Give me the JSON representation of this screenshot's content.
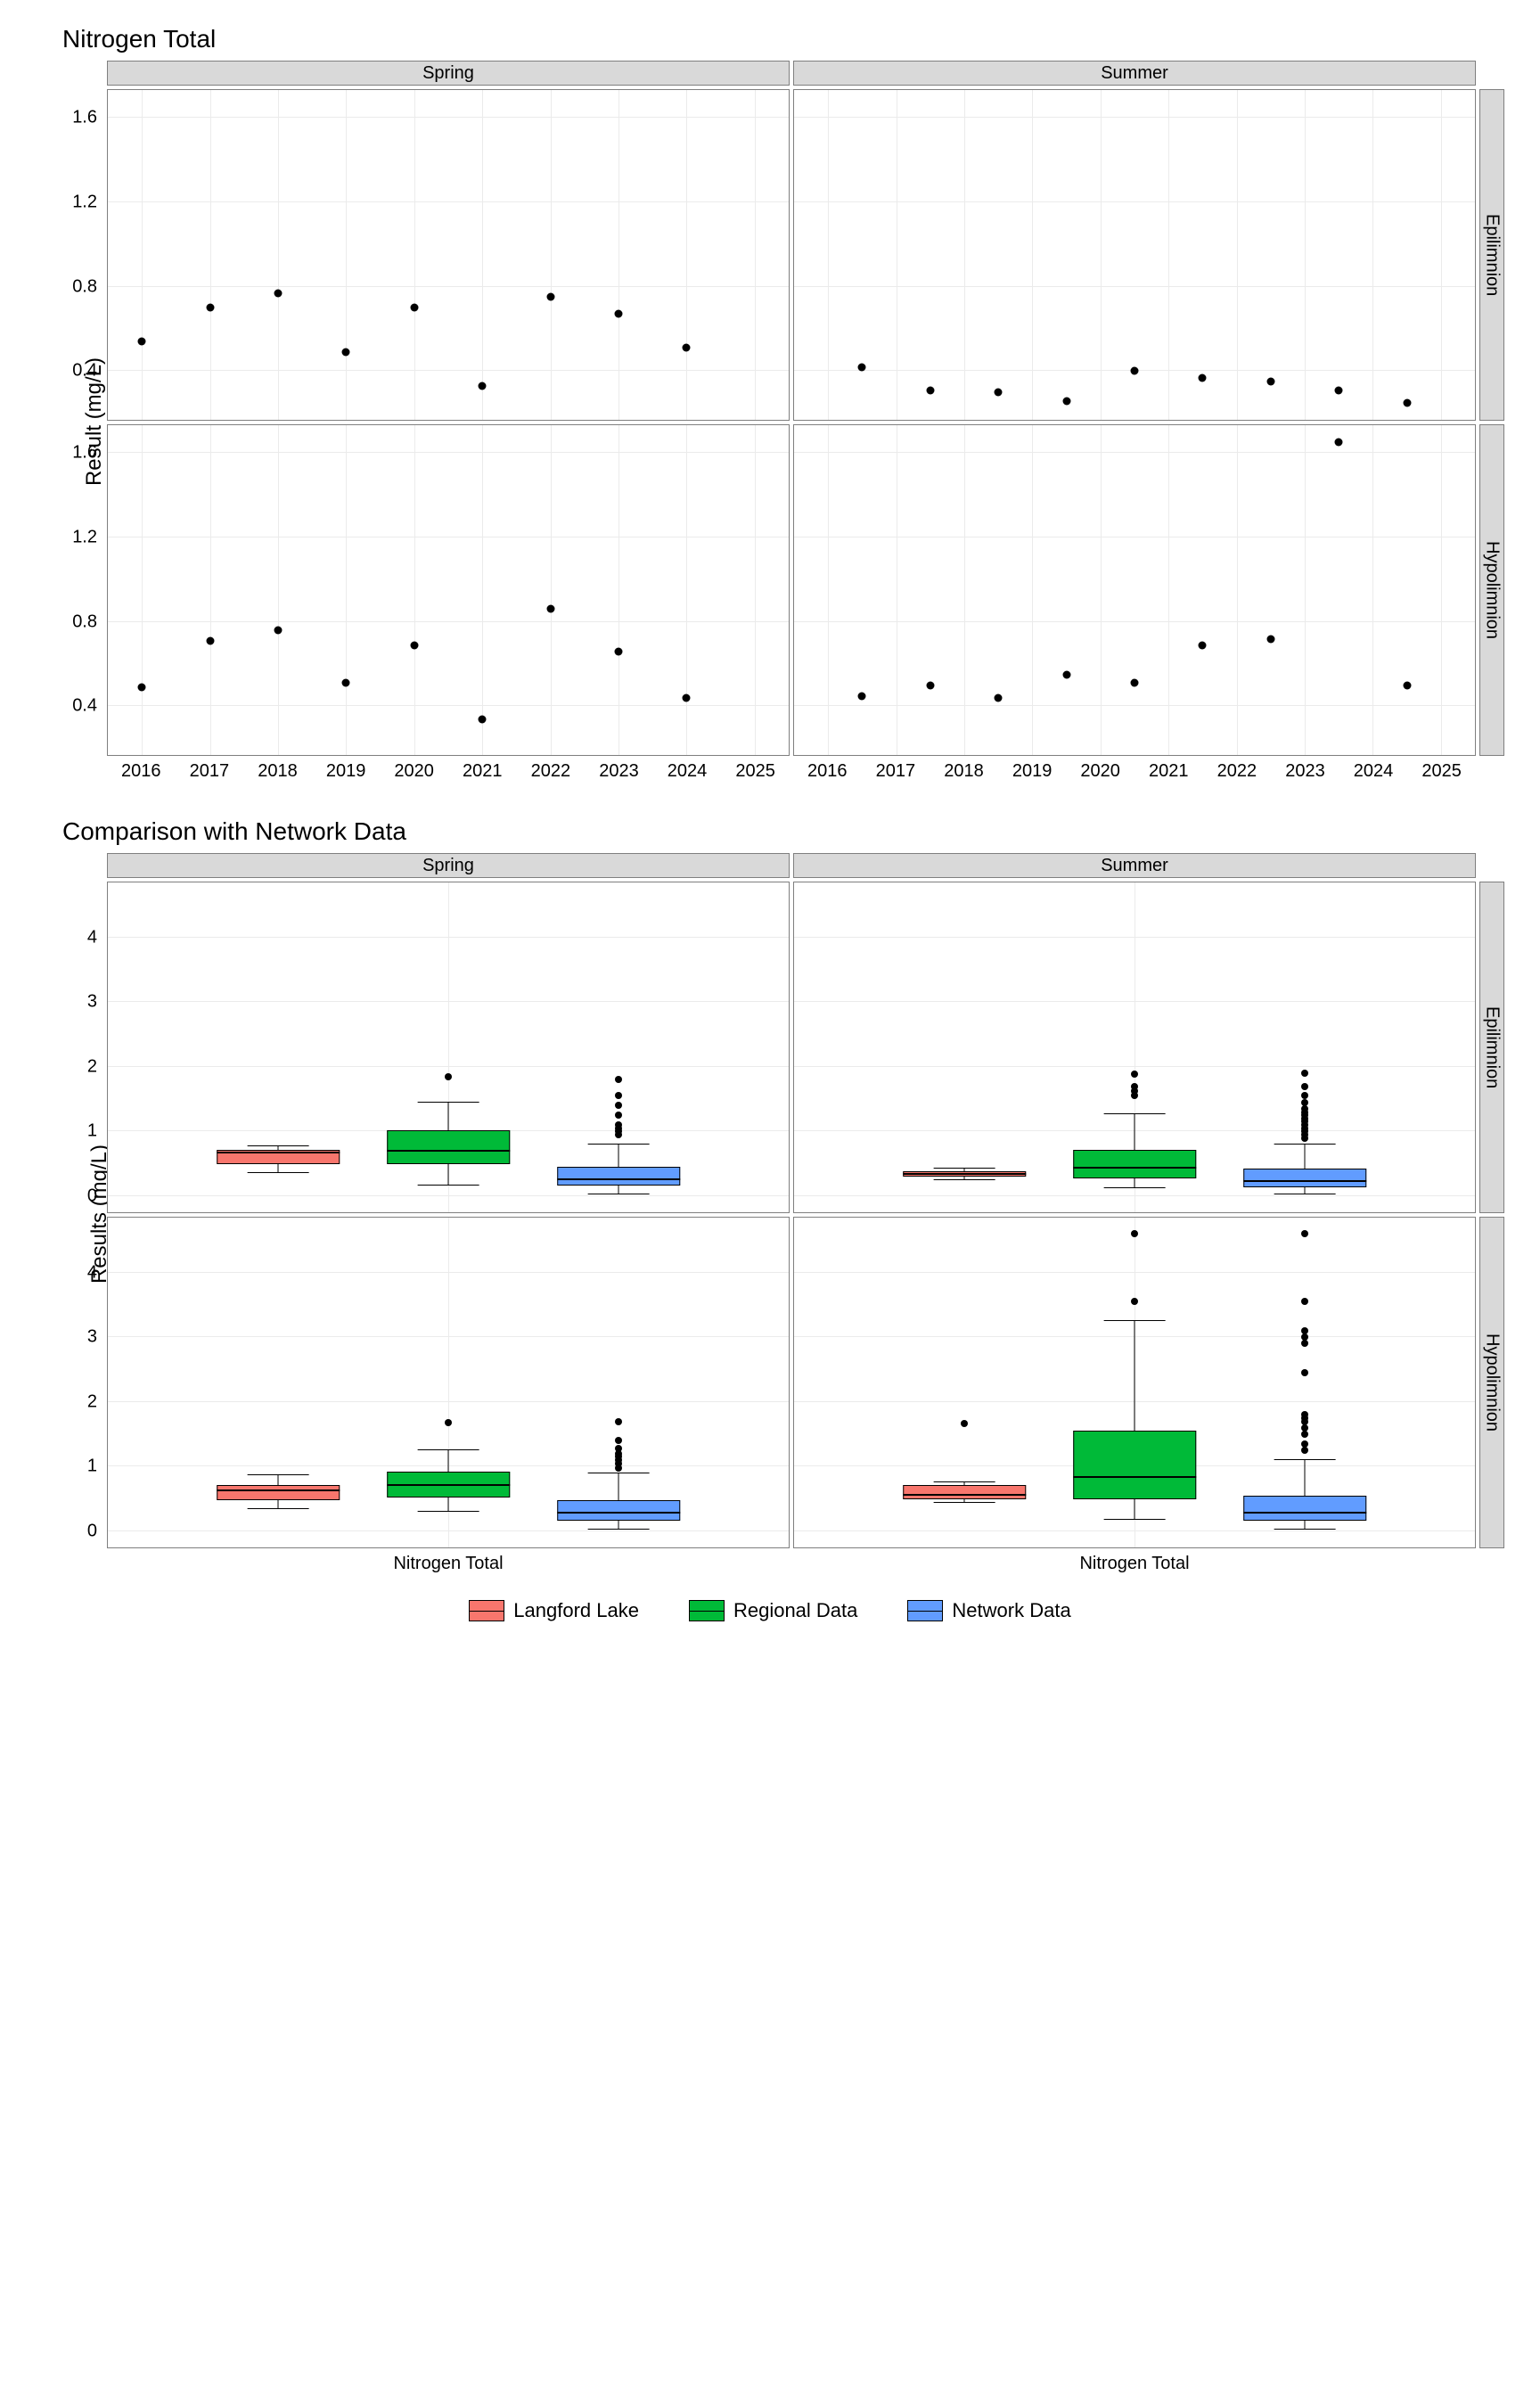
{
  "chart_data": [
    {
      "type": "scatter",
      "title": "Nitrogen Total",
      "ylabel": "Result (mg/L)",
      "cols": [
        "Spring",
        "Summer"
      ],
      "rows": [
        "Epilimnion",
        "Hypolimnion"
      ],
      "x_ticks": [
        "2016",
        "2017",
        "2018",
        "2019",
        "2020",
        "2021",
        "2022",
        "2023",
        "2024",
        "2025"
      ],
      "y_ticks": [
        0.4,
        0.8,
        1.2,
        1.6
      ],
      "xlim": [
        2015.5,
        2025.5
      ],
      "ylim": [
        0.17,
        1.73
      ],
      "panels": {
        "Spring|Epilimnion": [
          {
            "x": 2016,
            "y": 0.54
          },
          {
            "x": 2017,
            "y": 0.7
          },
          {
            "x": 2018,
            "y": 0.77
          },
          {
            "x": 2019,
            "y": 0.49
          },
          {
            "x": 2020,
            "y": 0.7
          },
          {
            "x": 2021,
            "y": 0.33
          },
          {
            "x": 2022,
            "y": 0.75
          },
          {
            "x": 2023,
            "y": 0.67
          },
          {
            "x": 2024,
            "y": 0.51
          }
        ],
        "Summer|Epilimnion": [
          {
            "x": 2016.5,
            "y": 0.42
          },
          {
            "x": 2017.5,
            "y": 0.31
          },
          {
            "x": 2018.5,
            "y": 0.3
          },
          {
            "x": 2019.5,
            "y": 0.26
          },
          {
            "x": 2020.5,
            "y": 0.4
          },
          {
            "x": 2021.5,
            "y": 0.37
          },
          {
            "x": 2022.5,
            "y": 0.35
          },
          {
            "x": 2023.5,
            "y": 0.31
          },
          {
            "x": 2024.5,
            "y": 0.25
          }
        ],
        "Spring|Hypolimnion": [
          {
            "x": 2016,
            "y": 0.49
          },
          {
            "x": 2017,
            "y": 0.71
          },
          {
            "x": 2018,
            "y": 0.76
          },
          {
            "x": 2019,
            "y": 0.51
          },
          {
            "x": 2020,
            "y": 0.69
          },
          {
            "x": 2021,
            "y": 0.34
          },
          {
            "x": 2022,
            "y": 0.86
          },
          {
            "x": 2023,
            "y": 0.66
          },
          {
            "x": 2024,
            "y": 0.44
          }
        ],
        "Summer|Hypolimnion": [
          {
            "x": 2016.5,
            "y": 0.45
          },
          {
            "x": 2017.5,
            "y": 0.5
          },
          {
            "x": 2018.5,
            "y": 0.44
          },
          {
            "x": 2019.5,
            "y": 0.55
          },
          {
            "x": 2020.5,
            "y": 0.51
          },
          {
            "x": 2021.5,
            "y": 0.69
          },
          {
            "x": 2022.5,
            "y": 0.72
          },
          {
            "x": 2023.5,
            "y": 1.65
          },
          {
            "x": 2024.5,
            "y": 0.5
          }
        ]
      }
    },
    {
      "type": "boxplot",
      "title": "Comparison with Network Data",
      "ylabel": "Results (mg/L)",
      "cols": [
        "Spring",
        "Summer"
      ],
      "rows": [
        "Epilimnion",
        "Hypolimnion"
      ],
      "x_label": "Nitrogen Total",
      "y_ticks": [
        0,
        1,
        2,
        3,
        4
      ],
      "ylim": [
        -0.25,
        4.85
      ],
      "series": [
        {
          "name": "Langford Lake",
          "color": "#F8766D"
        },
        {
          "name": "Regional Data",
          "color": "#00BA38"
        },
        {
          "name": "Network Data",
          "color": "#619CFF"
        }
      ],
      "panels": {
        "Spring|Epilimnion": [
          {
            "s": 0,
            "lw": 0.36,
            "q1": 0.5,
            "med": 0.67,
            "q3": 0.72,
            "uw": 0.77,
            "out": []
          },
          {
            "s": 1,
            "lw": 0.16,
            "q1": 0.5,
            "med": 0.68,
            "q3": 1.02,
            "uw": 1.45,
            "out": [
              1.85
            ]
          },
          {
            "s": 2,
            "lw": 0.02,
            "q1": 0.16,
            "med": 0.24,
            "q3": 0.45,
            "uw": 0.8,
            "out": [
              0.95,
              1.0,
              1.05,
              1.1,
              1.25,
              1.4,
              1.55,
              1.8
            ]
          }
        ],
        "Summer|Epilimnion": [
          {
            "s": 0,
            "lw": 0.25,
            "q1": 0.3,
            "med": 0.33,
            "q3": 0.38,
            "uw": 0.42,
            "out": []
          },
          {
            "s": 1,
            "lw": 0.12,
            "q1": 0.28,
            "med": 0.42,
            "q3": 0.72,
            "uw": 1.27,
            "out": [
              1.55,
              1.62,
              1.7,
              1.88
            ]
          },
          {
            "s": 2,
            "lw": 0.03,
            "q1": 0.14,
            "med": 0.22,
            "q3": 0.42,
            "uw": 0.8,
            "out": [
              0.9,
              0.95,
              1.0,
              1.05,
              1.1,
              1.15,
              1.2,
              1.25,
              1.3,
              1.35,
              1.45,
              1.55,
              1.7,
              1.9
            ]
          }
        ],
        "Spring|Hypolimnion": [
          {
            "s": 0,
            "lw": 0.34,
            "q1": 0.48,
            "med": 0.62,
            "q3": 0.72,
            "uw": 0.86,
            "out": []
          },
          {
            "s": 1,
            "lw": 0.3,
            "q1": 0.52,
            "med": 0.7,
            "q3": 0.92,
            "uw": 1.25,
            "out": [
              1.68
            ]
          },
          {
            "s": 2,
            "lw": 0.02,
            "q1": 0.17,
            "med": 0.27,
            "q3": 0.48,
            "uw": 0.9,
            "out": [
              0.98,
              1.05,
              1.1,
              1.15,
              1.2,
              1.28,
              1.4,
              1.7
            ]
          }
        ],
        "Summer|Hypolimnion": [
          {
            "s": 0,
            "lw": 0.44,
            "q1": 0.49,
            "med": 0.54,
            "q3": 0.71,
            "uw": 0.75,
            "out": [
              1.66
            ]
          },
          {
            "s": 1,
            "lw": 0.18,
            "q1": 0.5,
            "med": 0.82,
            "q3": 1.55,
            "uw": 3.25,
            "out": [
              3.55,
              4.6
            ]
          },
          {
            "s": 2,
            "lw": 0.03,
            "q1": 0.16,
            "med": 0.27,
            "q3": 0.55,
            "uw": 1.1,
            "out": [
              1.25,
              1.35,
              1.5,
              1.6,
              1.7,
              1.75,
              1.8,
              2.45,
              2.9,
              3.0,
              3.1,
              3.55,
              4.6
            ]
          }
        ]
      }
    }
  ]
}
